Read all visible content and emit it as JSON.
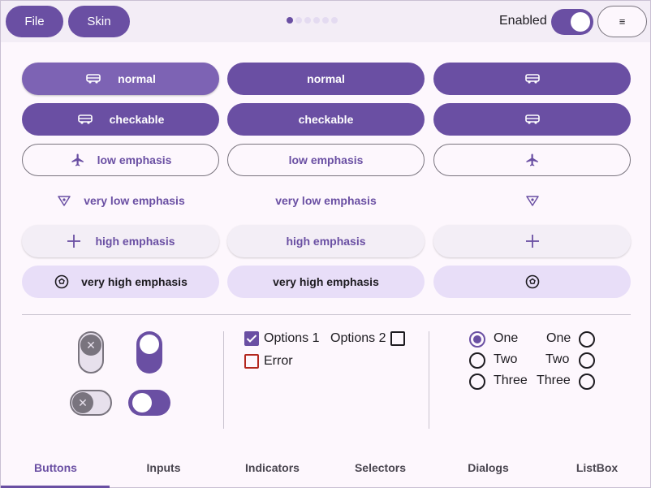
{
  "toolbar": {
    "file_label": "File",
    "skin_label": "Skin",
    "page_dots": 6,
    "active_dot": 0,
    "enabled_label": "Enabled",
    "enabled_on": true,
    "menu_icon": "hamburger-icon"
  },
  "buttons": {
    "normal": "normal",
    "checkable": "checkable",
    "low_emphasis": "low emphasis",
    "very_low_emphasis": "very low emphasis",
    "high_emphasis": "high emphasis",
    "very_high_emphasis": "very high emphasis"
  },
  "checks": {
    "options1": "Options 1",
    "options1_checked": true,
    "options2": "Options 2",
    "options2_checked": false,
    "error": "Error"
  },
  "radios": {
    "left": [
      "One",
      "Two",
      "Three"
    ],
    "right": [
      "One",
      "Two",
      "Three"
    ],
    "selected_left": 0
  },
  "tabs": [
    "Buttons",
    "Inputs",
    "Indicators",
    "Selectors",
    "Dialogs",
    "ListBox"
  ],
  "active_tab": 0,
  "colors": {
    "accent": "#6a4fa3",
    "background": "#fdf7fd",
    "tonal": "#e8def8"
  }
}
